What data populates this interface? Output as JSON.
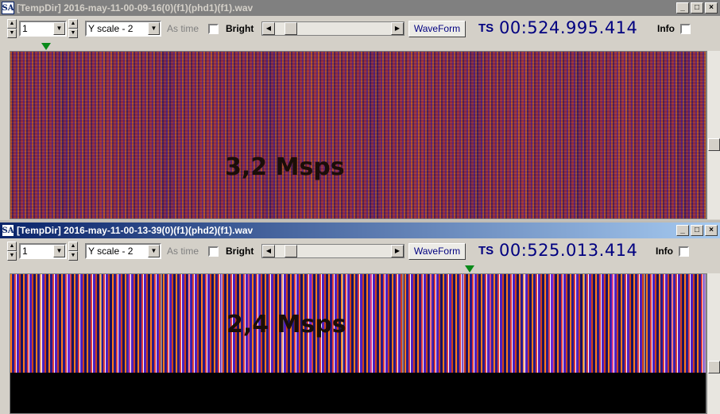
{
  "windows": [
    {
      "title": "[TempDir] 2016-may-11-00-09-16(0)(f1)(phd1)(f1).wav",
      "title_active": false,
      "app_icon_text": "SA",
      "channel_value": "1",
      "yscale_value": "Y scale - 2",
      "as_time_label": "As time",
      "bright_label": "Bright",
      "waveform_label": "WaveForm",
      "ts_label": "TS",
      "ts_value": "00:524.995.414",
      "info_label": "Info",
      "overlay_text": "3,2 Msps"
    },
    {
      "title": "[TempDir] 2016-may-11-00-13-39(0)(f1)(phd2)(f1).wav",
      "title_active": true,
      "app_icon_text": "SA",
      "channel_value": "1",
      "yscale_value": "Y scale - 2",
      "as_time_label": "As time",
      "bright_label": "Bright",
      "waveform_label": "WaveForm",
      "ts_label": "TS",
      "ts_value": "00:525.013.414",
      "info_label": "Info",
      "overlay_text": "2,4 Msps"
    }
  ],
  "window_buttons": {
    "minimize": "_",
    "maximize": "□",
    "close": "×"
  },
  "colors": {
    "title_inactive": "#808080",
    "title_active_start": "#0a246a",
    "title_active_end": "#a6caf0",
    "accent_text": "#000080",
    "marker": "#0a8a1a"
  }
}
